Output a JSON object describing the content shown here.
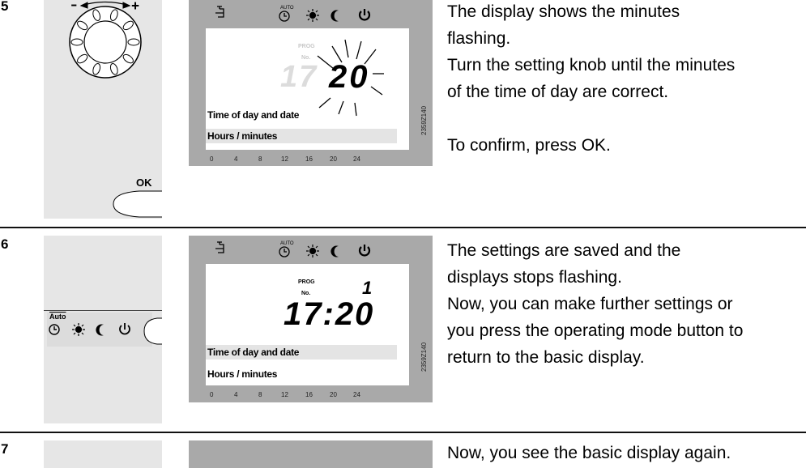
{
  "steps": [
    {
      "number": "5",
      "lcd": {
        "prog_label": "PROG",
        "no_label": "No.",
        "ghost_hours": "17",
        "minutes": "20",
        "line1": "Time of day and date",
        "line2": "Hours / minutes",
        "code": "2359Z140",
        "scale": [
          "0",
          "4",
          "8",
          "12",
          "16",
          "20",
          "24"
        ],
        "auto_label": "AUTO"
      },
      "ok_label": "OK",
      "description": [
        "The display shows the minutes",
        "flashing.",
        "Turn the setting knob until the minutes",
        "of the time of day are correct.",
        "",
        "To confirm, press OK."
      ]
    },
    {
      "number": "6",
      "lcd": {
        "prog_label": "PROG",
        "no_label": "No.",
        "program_no": "1",
        "time": "17:20",
        "line1": "Time of day and date",
        "line2": "Hours / minutes",
        "code": "2359Z140",
        "scale": [
          "0",
          "4",
          "8",
          "12",
          "16",
          "20",
          "24"
        ],
        "auto_label": "AUTO"
      },
      "mode_auto_label": "Auto",
      "description": [
        "The settings are saved and the",
        "displays stops flashing.",
        "Now, you can make further settings or",
        "you press the operating mode button to",
        "return to the basic display."
      ]
    },
    {
      "number": "7",
      "description": [
        "Now, you see the basic display again."
      ]
    }
  ]
}
